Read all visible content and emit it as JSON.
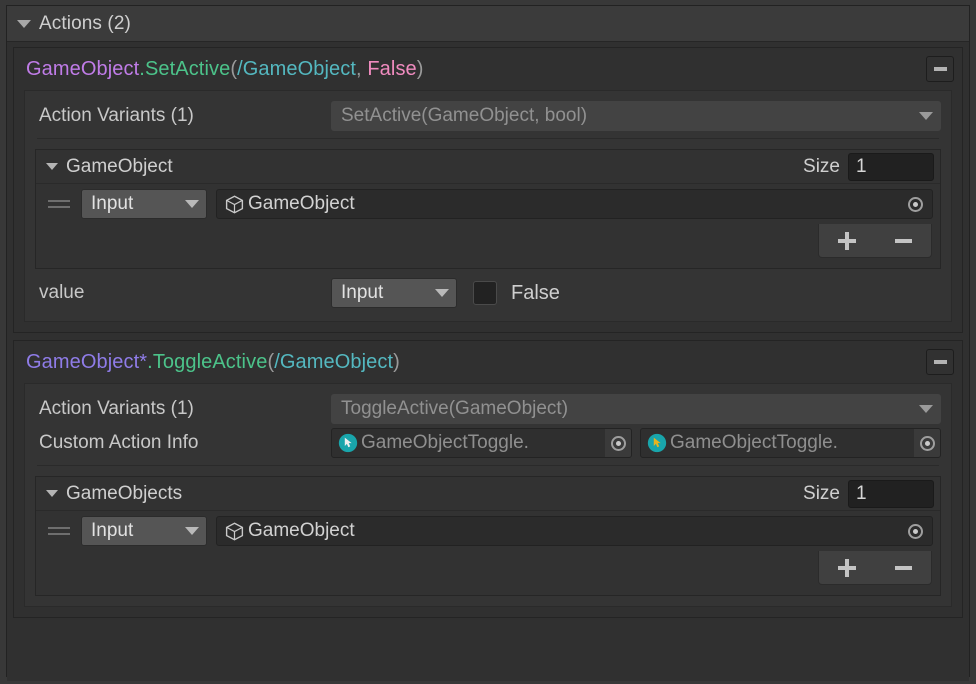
{
  "panel": {
    "header_label": "Actions (2)",
    "expanded": true,
    "foldout_icon": "triangle-down-icon"
  },
  "colors": {
    "background": "#383838",
    "card_background": "#303030",
    "inner_background": "#343434",
    "array_background": "#323232",
    "type_purple": "#c07ce8",
    "type_purple_alt": "#8f7ce8",
    "method_green": "#4cc38a",
    "path_teal": "#54b8c0",
    "bool_pink": "#f08bbf",
    "paren_gray": "#9a9a9a",
    "label_text": "#c8c8c8",
    "dim_text": "#8f8f8f",
    "script_icon_teal": "#19a5ab",
    "script_cursor_yellow": "#e8b31f",
    "popup_bright": "#555555",
    "popup_dim": "#434343"
  },
  "actions": [
    {
      "signature_tokens": [
        {
          "text": "GameObject",
          "color_key": "type_purple"
        },
        {
          "text": ".",
          "color_key": "method_green"
        },
        {
          "text": "SetActive",
          "color_key": "method_green"
        },
        {
          "text": "(",
          "color_key": "paren_gray"
        },
        {
          "text": "/GameObject",
          "color_key": "path_teal"
        },
        {
          "text": ", ",
          "color_key": "paren_gray"
        },
        {
          "text": "False",
          "color_key": "bool_pink"
        },
        {
          "text": ")",
          "color_key": "paren_gray"
        }
      ],
      "collapse_button": "collapse-icon",
      "variants_label": "Action Variants (1)",
      "variants_value": "SetActive(GameObject, bool)",
      "has_custom_action_info": false,
      "array": {
        "title": "GameObject",
        "size_label": "Size",
        "size_value": "1",
        "rows": [
          {
            "source_label": "Input",
            "object_value": "GameObject",
            "object_icon": "cube-icon"
          }
        ],
        "add_label": "+",
        "remove_label": "−"
      },
      "value_row": {
        "label": "value",
        "source_label": "Input",
        "checked": false,
        "bool_text": "False"
      }
    },
    {
      "signature_tokens": [
        {
          "text": "GameObject*",
          "color_key": "type_purple_alt"
        },
        {
          "text": ".",
          "color_key": "method_green"
        },
        {
          "text": "ToggleActive",
          "color_key": "method_green"
        },
        {
          "text": "(",
          "color_key": "paren_gray"
        },
        {
          "text": "/GameObject",
          "color_key": "path_teal"
        },
        {
          "text": ")",
          "color_key": "paren_gray"
        }
      ],
      "collapse_button": "collapse-icon",
      "variants_label": "Action Variants (1)",
      "variants_value": "ToggleActive(GameObject)",
      "has_custom_action_info": true,
      "custom_action_info": {
        "label": "Custom Action Info",
        "fields": [
          {
            "value": "GameObjectToggle.",
            "icon": "script-icon",
            "cursor_color": "white"
          },
          {
            "value": "GameObjectToggle.",
            "icon": "script-icon",
            "cursor_color": "yellow"
          }
        ]
      },
      "array": {
        "title": "GameObjects",
        "size_label": "Size",
        "size_value": "1",
        "rows": [
          {
            "source_label": "Input",
            "object_value": "GameObject",
            "object_icon": "cube-icon"
          }
        ],
        "add_label": "+",
        "remove_label": "−"
      },
      "value_row": null
    }
  ]
}
